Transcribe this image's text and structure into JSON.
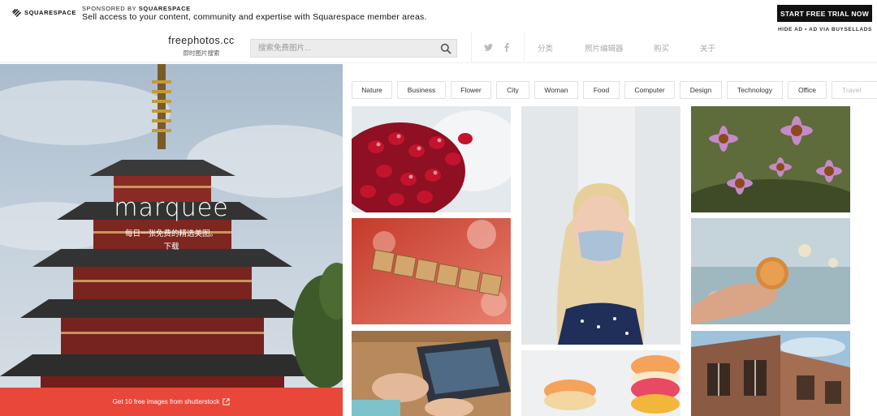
{
  "ad": {
    "logo_text": "SQUARESPACE",
    "sponsor_prefix": "SPONSORED BY",
    "sponsor_name": "SQUARESPACE",
    "message": "Sell access to your content, community and expertise with Squarespace member areas.",
    "cta_label": "START FREE TRIAL NOW",
    "hide_label": "HIDE AD • AD VIA BUYSELLADS"
  },
  "header": {
    "brand_name": "freephotos.cc",
    "brand_tagline": "即时图片搜索",
    "search_placeholder": "搜索免费图片...",
    "nav": [
      "分类",
      "照片编辑器",
      "购买",
      "关于"
    ]
  },
  "hero": {
    "title": "marquee",
    "subtitle": "每日一张免费的精选美图。",
    "download_label": "下载",
    "shutterstock_text": "Get 10 free images from shutterstock"
  },
  "categories": [
    "Nature",
    "Business",
    "Flower",
    "City",
    "Woman",
    "Food",
    "Computer",
    "Design",
    "Technology",
    "Office",
    "Travel"
  ],
  "photos": [
    "pomegranate-seeds",
    "dating-letter-tiles",
    "laptop-on-desk",
    "woman-face-mask",
    "macarons",
    "purple-coneflowers",
    "bitcoin-in-hand",
    "old-building"
  ],
  "colors": {
    "accent_red": "#e9473a",
    "ad_button": "#111111",
    "nav_text": "#aaaaaa"
  }
}
